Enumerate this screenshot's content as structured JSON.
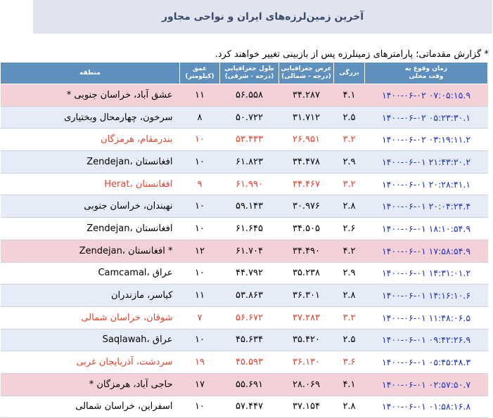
{
  "header": {
    "title": "آخرین زمین‌لرزه‌های ایران و نواحی مجاور"
  },
  "note": "* گزارش مقدماتی؛ پارامترهای زمینلرزه پس از بازبینی تغییر خواهند کرد.",
  "columns": {
    "time_l1": "زمان وقوع به",
    "time_l2": "وقت محلی",
    "mag": "بزرگی",
    "lat_l1": "عرض جغرافیایی",
    "lat_l2": "(درجه - شمالی)",
    "lon_l1": "طول جغرافیایی",
    "lon_l2": "(درجه - شرقی)",
    "depth_l1": "عمق",
    "depth_l2": "(کیلومتر)",
    "region": "منطقه"
  },
  "rows": [
    {
      "time": "۱۴۰۰-۰۶-۰۲ ۰۷:۰۵:۱۵.۹",
      "mag": "۴.۱",
      "lat": "۳۴.۲۸۷",
      "lon": "۵۶.۵۵۸",
      "depth": "۱۱",
      "region": "عشق آباد، خراسان جنوبی *",
      "bg": "pink",
      "red": false
    },
    {
      "time": "۱۴۰۰-۰۶-۰۲ ۰۵:۲۳:۳۰.۱",
      "mag": "۲.۵",
      "lat": "۳۱.۷۱۲",
      "lon": "۵۰.۷۲۲",
      "depth": "۸",
      "region": "سرخون، چهارمحال وبختیاری",
      "bg": "blue",
      "red": false
    },
    {
      "time": "۱۴۰۰-۰۶-۰۲ ۰۳:۱۹:۱۱.۲",
      "mag": "۳.۲",
      "lat": "۲۶.۹۵۱",
      "lon": "۵۳.۴۳۳",
      "depth": "۱۰",
      "region": "بندرمقام، هرمزگان",
      "bg": "white",
      "red": true
    },
    {
      "time": "۱۴۰۰-۰۶-۰۱ ۲۱:۴۳:۲۰.۲",
      "mag": "۲.۹",
      "lat": "۳۴.۴۷۸",
      "lon": "۶۱.۸۲۳",
      "depth": "۱۰",
      "region": "Zendejan، افغانستان",
      "bg": "blue",
      "red": false
    },
    {
      "time": "۱۴۰۰-۰۶-۰۱ ۲۰:۲۸:۴۱.۱",
      "mag": "۳.۲",
      "lat": "۳۴.۴۶۷",
      "lon": "۶۱.۹۹۰",
      "depth": "۹",
      "region": "Herat، افغانستان",
      "bg": "white",
      "red": true
    },
    {
      "time": "۱۴۰۰-۰۶-۰۱ ۲۰:۰۴:۲۴.۴",
      "mag": "۲.۸",
      "lat": "۳۰.۹۷۶",
      "lon": "۵۹.۱۴۳",
      "depth": "۱۰",
      "region": "نهبندان، خراسان جنوبی",
      "bg": "blue",
      "red": false
    },
    {
      "time": "۱۴۰۰-۰۶-۰۱ ۱۸:۱۰:۵۴.۹",
      "mag": "۲.۶",
      "lat": "۳۴.۵۰۵",
      "lon": "۶۱.۶۴۵",
      "depth": "۱۰",
      "region": "Zendejan، افغانستان",
      "bg": "white",
      "red": false
    },
    {
      "time": "۱۴۰۰-۰۶-۰۱ ۱۷:۵۸:۵۴.۹",
      "mag": "۴.۲",
      "lat": "۳۴.۴۹۰",
      "lon": "۶۱.۷۰۴",
      "depth": "۱۲",
      "region": "Zendejan، افغانستان *",
      "bg": "pink",
      "red": false
    },
    {
      "time": "۱۴۰۰-۰۶-۰۱ ۱۴:۳۱:۰۱.۲",
      "mag": "۲.۹",
      "lat": "۳۵.۲۳۸",
      "lon": "۴۴.۷۹۲",
      "depth": "۱۰",
      "region": "Camcamal، عراق",
      "bg": "white",
      "red": false
    },
    {
      "time": "۱۴۰۰-۰۶-۰۱ ۱۴:۱۶:۱۰.۶",
      "mag": "۲.۸",
      "lat": "۳۶.۳۰۱",
      "lon": "۵۳.۸۶۳",
      "depth": "۱۱",
      "region": "کیاسر، مازندران",
      "bg": "blue",
      "red": false
    },
    {
      "time": "۱۴۰۰-۰۶-۰۱ ۱۱:۴۸:۰۶.۵",
      "mag": "۳.۲",
      "lat": "۳۷.۲۸۳",
      "lon": "۵۶.۶۷۲",
      "depth": "۷",
      "region": "شوقان، خراسان شمالی",
      "bg": "white",
      "red": true
    },
    {
      "time": "۱۴۰۰-۰۶-۰۱ ۰۹:۴۲:۲۶.۹",
      "mag": "۲.۵",
      "lat": "۳۵.۴۲۰",
      "lon": "۴۵.۶۳۴",
      "depth": "۱۰",
      "region": "Saqlawah، عراق",
      "bg": "blue",
      "red": false
    },
    {
      "time": "۱۴۰۰-۰۶-۰۱ ۰۵:۴۵:۴۸.۳",
      "mag": "۳.۶",
      "lat": "۳۶.۱۳۰",
      "lon": "۴۵.۵۹۳",
      "depth": "۱۹",
      "region": "سردشت، آذربایجان غربی",
      "bg": "white",
      "red": true
    },
    {
      "time": "۱۴۰۰-۰۶-۰۱ ۰۲:۵۷:۵۰.۷",
      "mag": "۴.۱",
      "lat": "۲۸.۰۶۹",
      "lon": "۵۵.۶۹۱",
      "depth": "۱۷",
      "region": "حاجی آباد، هرمزگان *",
      "bg": "pink",
      "red": false
    },
    {
      "time": "۱۴۰۰-۰۶-۰۱ ۰۱:۵۸:۱۶.۸",
      "mag": "۲.۸",
      "lat": "۳۷.۱۵۴",
      "lon": "۵۷.۴۴۷",
      "depth": "۱۰",
      "region": "اسفراین، خراسان شمالی",
      "bg": "white",
      "red": false
    }
  ]
}
